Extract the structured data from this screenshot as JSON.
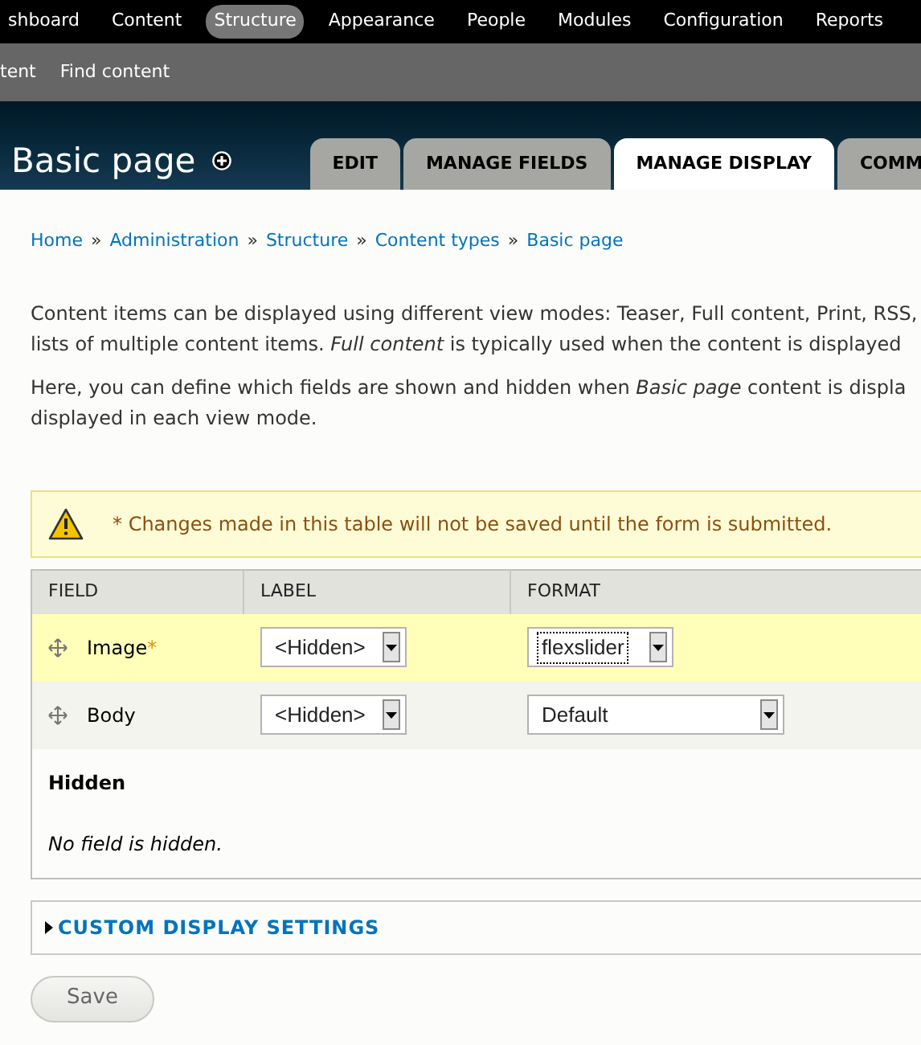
{
  "toolbar": {
    "items": [
      {
        "label": "shboard",
        "selected": false
      },
      {
        "label": "Content",
        "selected": false
      },
      {
        "label": "Structure",
        "selected": true
      },
      {
        "label": "Appearance",
        "selected": false
      },
      {
        "label": "People",
        "selected": false
      },
      {
        "label": "Modules",
        "selected": false
      },
      {
        "label": "Configuration",
        "selected": false
      },
      {
        "label": "Reports",
        "selected": false
      }
    ]
  },
  "shortcuts": [
    "tent",
    "Find content"
  ],
  "header": {
    "title": "Basic page",
    "tabs": [
      {
        "label": "EDIT",
        "selected": false
      },
      {
        "label": "MANAGE FIELDS",
        "selected": false
      },
      {
        "label": "MANAGE DISPLAY",
        "selected": true
      },
      {
        "label": "COMM",
        "selected": false
      }
    ]
  },
  "breadcrumb": [
    "Home",
    "Administration",
    "Structure",
    "Content types",
    "Basic page"
  ],
  "breadcrumb_separator": "»",
  "description": [
    [
      "Content items can be displayed using different view modes: Teaser, Full content, Print, RSS,",
      "lists of multiple content items. *Full content* is typically used when the content is displayed"
    ],
    [
      "Here, you can define which fields are shown and hidden when *Basic page* content is displa",
      "displayed in each view mode."
    ]
  ],
  "warning": "* Changes made in this table will not be saved until the form is submitted.",
  "table": {
    "columns": [
      "FIELD",
      "LABEL",
      "FORMAT"
    ],
    "rows": [
      {
        "field": "Image",
        "marker": "*",
        "changed": true,
        "label": {
          "value": "<Hidden>",
          "focused": false
        },
        "format": {
          "value": "flexslider",
          "focused": true,
          "wide": false
        }
      },
      {
        "field": "Body",
        "changed": false,
        "label": {
          "value": "<Hidden>",
          "focused": false
        },
        "format": {
          "value": "Default",
          "focused": false,
          "wide": true
        }
      }
    ],
    "hidden_heading": "Hidden",
    "hidden_empty": "No field is hidden."
  },
  "custom_settings": {
    "label": "CUSTOM DISPLAY SETTINGS",
    "expanded": false
  },
  "save_button": "Save"
}
